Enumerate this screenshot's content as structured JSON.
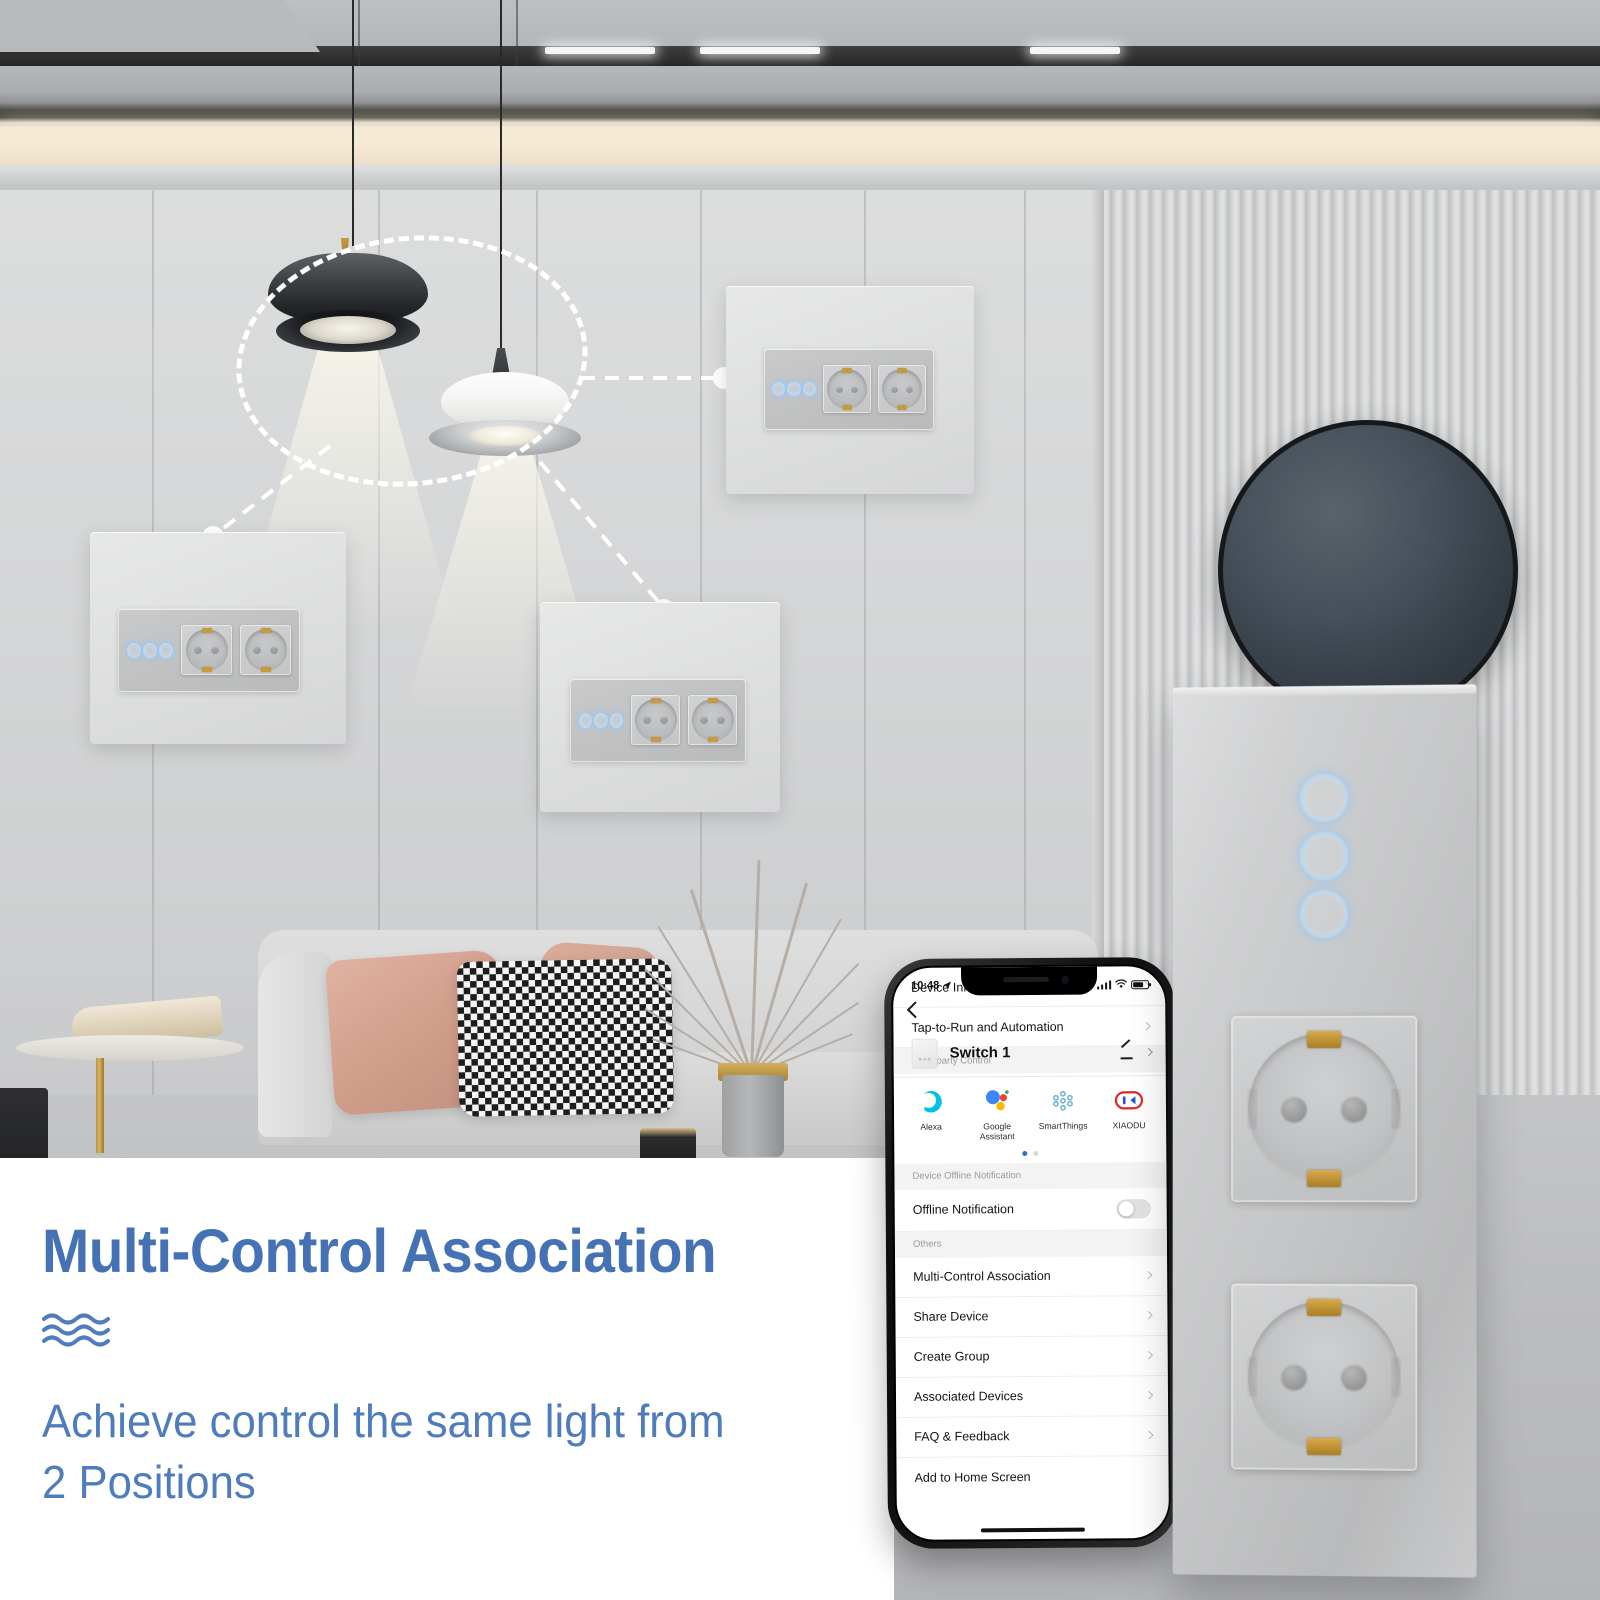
{
  "headline": "Multi-Control Association",
  "subline": "Achieve control the same light from 2 Positions",
  "wave_icon": "waves-icon",
  "colors": {
    "headline_blue": "#4472b5",
    "subline_blue": "#4f7cbd",
    "led_blue": "#b9d8f2",
    "panel_grey": "#c4c5c6"
  },
  "phone": {
    "status": {
      "time": "10:48",
      "location_icon": "location-arrow-icon",
      "signal_icon": "cellular-signal-icon",
      "wifi_icon": "wifi-icon",
      "battery_icon": "battery-icon"
    },
    "nav": {
      "back_icon": "back-chevron-icon"
    },
    "device": {
      "title": "Switch 1",
      "thumb_icon": "switch-panel-thumbnail-icon",
      "edit_icon": "pencil-edit-icon",
      "chevron_icon": "chevron-right-icon"
    },
    "rows_top": [
      {
        "label": "Device Information"
      },
      {
        "label": "Tap-to-Run and Automation"
      }
    ],
    "third_party": {
      "section_label": "Third-party Control",
      "items": [
        {
          "label": "Alexa",
          "icon": "alexa-icon",
          "color": "#00c2e8"
        },
        {
          "label": "Google Assistant",
          "icon": "google-assistant-icon",
          "color": "#4285f4"
        },
        {
          "label": "SmartThings",
          "icon": "smartthings-icon",
          "color": "#6fb3d8"
        },
        {
          "label": "XIAODU",
          "icon": "xiaodu-icon",
          "color": "#e0252c"
        }
      ],
      "page_dots": 2,
      "active_dot": 0
    },
    "offline_section": {
      "section_label": "Device Offline Notification",
      "row_label": "Offline Notification",
      "toggle_state": "off",
      "toggle_icon": "toggle-switch-icon"
    },
    "others_section": {
      "section_label": "Others",
      "rows": [
        {
          "label": "Multi-Control Association"
        },
        {
          "label": "Share Device"
        },
        {
          "label": "Create Group"
        },
        {
          "label": "Associated Devices"
        },
        {
          "label": "FAQ & Feedback"
        },
        {
          "label": "Add to Home Screen"
        }
      ]
    },
    "home_indicator_icon": "home-indicator-icon"
  },
  "product": {
    "name": "wall-switch-socket-panel",
    "gang_count": 3,
    "gang_icon": "touch-led-ring-icon",
    "socket_count": 2,
    "socket_icon": "schuko-socket-icon"
  },
  "scene": {
    "dashed_highlight_icon": "dashed-ellipse-highlight",
    "lamps": [
      {
        "name": "pendant-lamp-dark",
        "icon": "pendant-lamp-icon"
      },
      {
        "name": "pendant-lamp-white",
        "icon": "pendant-lamp-icon"
      }
    ],
    "wall_panels": [
      {
        "name": "wall-panel-top-right",
        "gangs": 3,
        "sockets": 2
      },
      {
        "name": "wall-panel-left",
        "gangs": 3,
        "sockets": 2
      },
      {
        "name": "wall-panel-middle",
        "gangs": 3,
        "sockets": 2
      }
    ],
    "furniture": [
      {
        "name": "sofa"
      },
      {
        "name": "pillow-pink"
      },
      {
        "name": "pillow-houndstooth"
      },
      {
        "name": "vase-with-branches"
      },
      {
        "name": "side-table"
      },
      {
        "name": "wall-round-decor"
      },
      {
        "name": "ceiling-light-strip"
      }
    ]
  }
}
